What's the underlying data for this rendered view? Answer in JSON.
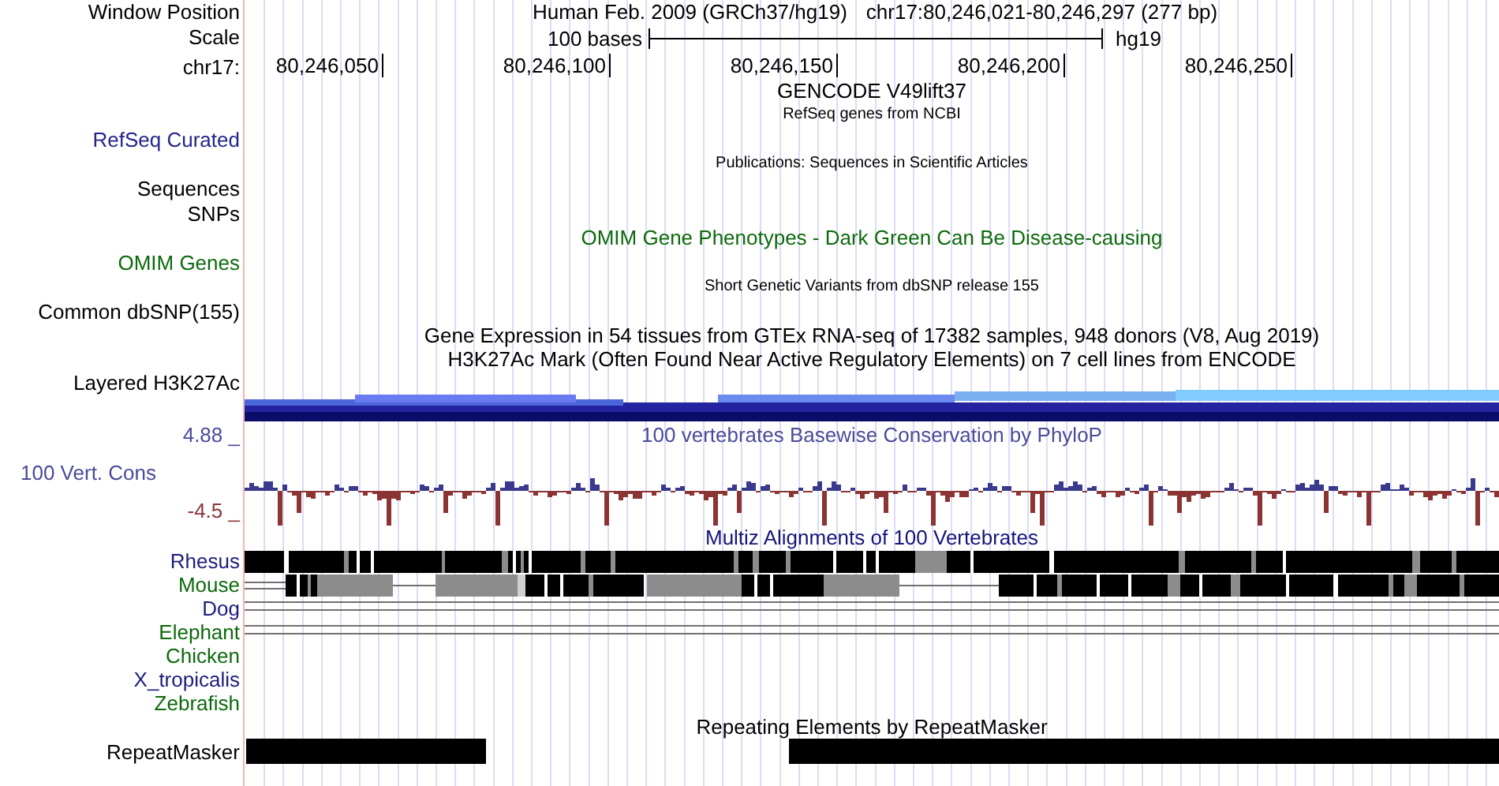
{
  "header": {
    "position_label": "Window Position",
    "assembly": "Human Feb. 2009 (GRCh37/hg19)",
    "position": "chr17:80,246,021-80,246,297 (277 bp)",
    "scale_label": "Scale",
    "scale_length": "100 bases",
    "scale_db": "hg19",
    "chrom_label": "chr17:",
    "ruler_ticks": [
      "80,246,050",
      "80,246,100",
      "80,246,150",
      "80,246,200",
      "80,246,250"
    ]
  },
  "rows": [
    {
      "kind": "title",
      "text": "GENCODE V49lift37",
      "color": "#000000"
    },
    {
      "kind": "caption",
      "text": "RefSeq genes from NCBI"
    },
    {
      "kind": "label",
      "text": "RefSeq Curated",
      "color": "#24248c"
    },
    {
      "kind": "caption",
      "text": "Publications: Sequences in Scientific Articles"
    },
    {
      "kind": "label",
      "text": "Sequences",
      "color": "#000000"
    },
    {
      "kind": "label",
      "text": "SNPs",
      "color": "#000000"
    },
    {
      "kind": "title",
      "text": "OMIM Gene Phenotypes - Dark Green Can Be Disease-causing",
      "color": "#0c6a0c"
    },
    {
      "kind": "label",
      "text": "OMIM Genes",
      "color": "#0c6a0c"
    },
    {
      "kind": "caption",
      "text": "Short Genetic Variants from dbSNP release 155"
    },
    {
      "kind": "label",
      "text": "Common dbSNP(155)",
      "color": "#000000"
    },
    {
      "kind": "title",
      "text": "Gene Expression in 54 tissues from GTEx RNA-seq of 17382 samples, 948 donors (V8, Aug 2019)",
      "color": "#000000"
    },
    {
      "kind": "title",
      "text": "H3K27Ac Mark (Often Found Near Active Regulatory Elements) on 7 cell lines from ENCODE",
      "color": "#000000"
    },
    {
      "kind": "layered",
      "text": "Layered H3K27Ac"
    },
    {
      "kind": "wiggle",
      "title": "100 vertebrates Basewise Conservation by PhyloP",
      "label": "100 Vert. Cons",
      "max": "4.88 _",
      "min": "-4.5 _"
    },
    {
      "kind": "title",
      "text": "Multiz Alignments of 100 Vertebrates",
      "color": "#14147a"
    },
    {
      "kind": "species",
      "text": "Rhesus",
      "color": "#1c1c7c",
      "alignment": {
        "kind": "full"
      }
    },
    {
      "kind": "species",
      "text": "Mouse",
      "color": "#0c6a0c",
      "alignment": {
        "kind": "partial"
      }
    },
    {
      "kind": "species",
      "text": "Dog",
      "color": "#1c1c7c",
      "alignment": {
        "kind": "gap"
      }
    },
    {
      "kind": "species",
      "text": "Elephant",
      "color": "#0c6a0c",
      "alignment": {
        "kind": "gap"
      }
    },
    {
      "kind": "species",
      "text": "Chicken",
      "color": "#0c6a0c"
    },
    {
      "kind": "species",
      "text": "X_tropicalis",
      "color": "#1c1c7c"
    },
    {
      "kind": "species",
      "text": "Zebrafish",
      "color": "#0c6a0c"
    },
    {
      "kind": "title",
      "text": "Repeating Elements by RepeatMasker",
      "color": "#000000"
    },
    {
      "kind": "repeat",
      "text": "RepeatMasker"
    }
  ]
}
